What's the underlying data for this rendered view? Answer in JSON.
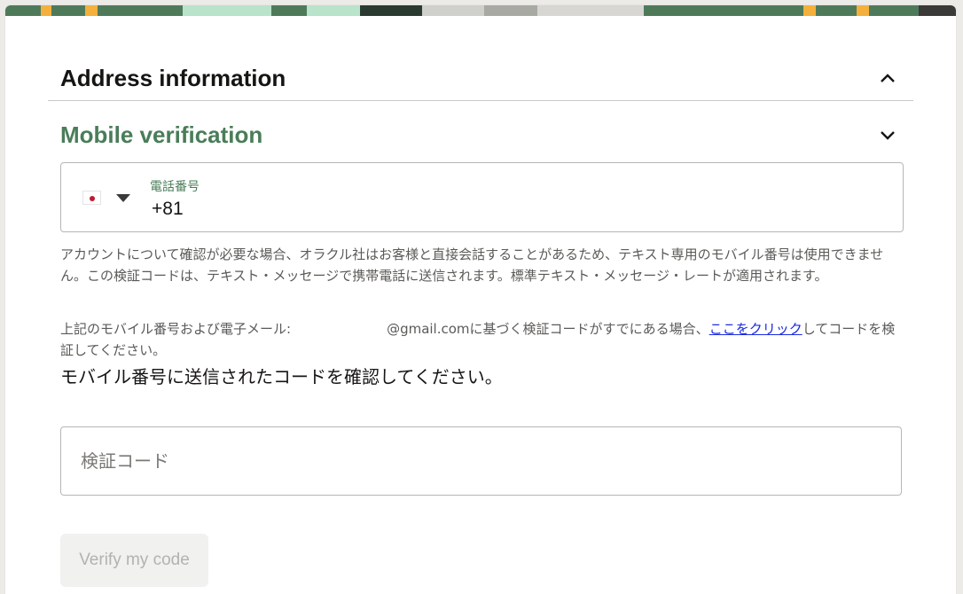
{
  "sections": {
    "address_title": "Address information",
    "mobile_title": "Mobile verification"
  },
  "phone": {
    "country_flag": "Japan",
    "label": "電話番号",
    "value": "+81"
  },
  "help": {
    "notice": "アカウントについて確認が必要な場合、オラクル社はお客様と直接会話することがあるため、テキスト専用のモバイル番号は使用できません。この検証コードは、テキスト・メッセージで携帯電話に送信されます。標準テキスト・メッセージ・レートが適用されます。",
    "existing_code_prefix": "上記のモバイル番号および電子メール:",
    "existing_code_email": "@gmail.com",
    "existing_code_middle": "に基づく検証コードがすでにある場合、",
    "existing_code_link": "ここをクリック",
    "existing_code_suffix": "してコードを検証してください。"
  },
  "instruction": "モバイル番号に送信されたコードを確認してください。",
  "code_field": {
    "placeholder": "検証コード",
    "value": ""
  },
  "verify_button": "Verify my code",
  "colors": {
    "accent_green": "#4a7d59",
    "link_blue": "#1a2be0"
  }
}
